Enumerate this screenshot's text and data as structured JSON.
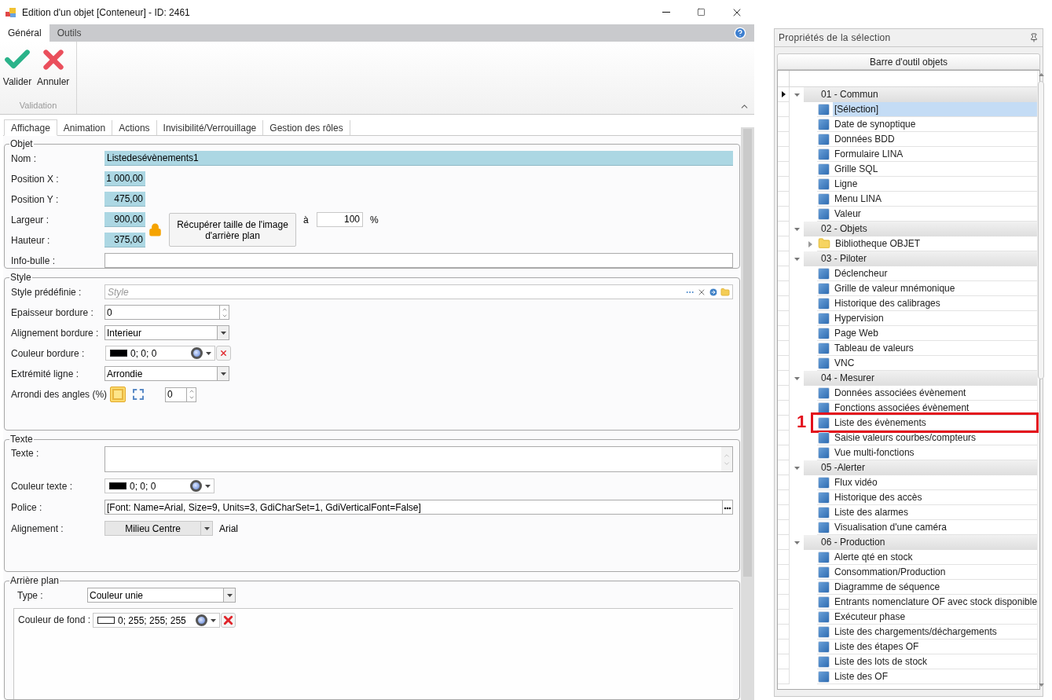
{
  "window": {
    "title": "Edition d'un objet [Conteneur] - ID: 2461"
  },
  "ribbon": {
    "tabs": [
      {
        "label": "Général",
        "selected": true
      },
      {
        "label": "Outils",
        "selected": false
      }
    ],
    "buttons": [
      {
        "kind": "ok",
        "label": "Valider"
      },
      {
        "kind": "cancel",
        "label": "Annuler"
      }
    ],
    "group_label": "Validation"
  },
  "tabs": [
    {
      "label": "Affichage",
      "selected": true
    },
    {
      "label": "Animation",
      "selected": false
    },
    {
      "label": "Actions",
      "selected": false
    },
    {
      "label": "Invisibilité/Verrouillage",
      "selected": false
    },
    {
      "label": "Gestion des rôles",
      "selected": false
    }
  ],
  "objet": {
    "title": "Objet",
    "name": {
      "label": "Nom :",
      "value": "Listedesévènements1"
    },
    "position_x": {
      "label": "Position X :",
      "value": "1 000,00"
    },
    "position_y": {
      "label": "Position Y :",
      "value": "475,00"
    },
    "width": {
      "label": "Largeur :",
      "value": "900,00"
    },
    "height": {
      "label": "Hauteur :",
      "value": "375,00"
    },
    "locked": true,
    "fetch_button": "Récupérer taille de l'image d'arrière plan",
    "scale": {
      "label": "à",
      "value": "100",
      "unit": "%"
    },
    "tooltip": {
      "label": "Info-bulle :"
    }
  },
  "style": {
    "title": "Style",
    "preset": {
      "label": "Style prédéfinie :",
      "placeholder": "Style"
    },
    "border_width": {
      "label": "Epaisseur bordure :",
      "value": "0"
    },
    "border_align": {
      "label": "Alignement bordure :",
      "value": "Interieur"
    },
    "border_color": {
      "label": "Couleur bordure :",
      "value": "0; 0; 0",
      "color": "#000000"
    },
    "line_end": {
      "label": "Extrémité ligne :",
      "value": "Arrondie"
    },
    "corner": {
      "label": "Arrondi des angles (%)",
      "value": "0",
      "modes": [
        {
          "selected": true
        },
        {
          "selected": false
        }
      ]
    }
  },
  "texte": {
    "title": "Texte",
    "text": {
      "label": "Texte :"
    },
    "color": {
      "label": "Couleur texte :",
      "value": "0; 0; 0",
      "color": "#000000"
    },
    "font": {
      "label": "Police :",
      "value": "[Font: Name=Arial, Size=9, Units=3, GdiCharSet=1, GdiVerticalFont=False]"
    },
    "align": {
      "label": "Alignement :",
      "value": "Milieu Centre",
      "font_name": "Arial"
    }
  },
  "background": {
    "title": "Arrière plan",
    "type": {
      "label": "Type :",
      "value": "Couleur unie"
    },
    "color": {
      "label": "Couleur de fond :",
      "value": "0; 255; 255; 255",
      "color": "#ffffff"
    }
  },
  "panel": {
    "title": "Propriétés de la sélection",
    "toolbar_title": "Barre d'outil objets",
    "groups": [
      {
        "label": "01 - Commun",
        "expanded": true,
        "current": true,
        "items": [
          {
            "label": "[Sélection]",
            "kind": "item",
            "selected": true
          },
          {
            "label": "Date de synoptique",
            "kind": "item",
            "selected": false
          },
          {
            "label": "Données BDD",
            "kind": "item",
            "selected": false
          },
          {
            "label": "Formulaire LINA",
            "kind": "item",
            "selected": false
          },
          {
            "label": "Grille SQL",
            "kind": "item",
            "selected": false
          },
          {
            "label": "Ligne",
            "kind": "item",
            "selected": false
          },
          {
            "label": "Menu LINA",
            "kind": "item",
            "selected": false
          },
          {
            "label": "Valeur",
            "kind": "item",
            "selected": false
          }
        ]
      },
      {
        "label": "02 - Objets",
        "expanded": true,
        "current": false,
        "items": [
          {
            "label": "Bibliotheque OBJET",
            "kind": "folder",
            "selected": false
          }
        ]
      },
      {
        "label": "03 - Piloter",
        "expanded": true,
        "current": false,
        "items": [
          {
            "label": "Déclencheur",
            "kind": "item",
            "selected": false
          },
          {
            "label": "Grille de valeur mnémonique",
            "kind": "item",
            "selected": false
          },
          {
            "label": "Historique des calibrages",
            "kind": "item",
            "selected": false
          },
          {
            "label": "Hypervision",
            "kind": "item",
            "selected": false
          },
          {
            "label": "Page Web",
            "kind": "item",
            "selected": false
          },
          {
            "label": "Tableau de valeurs",
            "kind": "item",
            "selected": false
          },
          {
            "label": "VNC",
            "kind": "item",
            "selected": false
          }
        ]
      },
      {
        "label": "04 - Mesurer",
        "expanded": true,
        "current": false,
        "items": [
          {
            "label": "Données associées évènement",
            "kind": "item",
            "selected": false
          },
          {
            "label": "Fonctions associées évènement",
            "kind": "item",
            "selected": false
          },
          {
            "label": "Liste des évènements",
            "kind": "item",
            "selected": false,
            "callout": "1"
          },
          {
            "label": "Saisie valeurs courbes/compteurs",
            "kind": "item",
            "selected": false
          },
          {
            "label": "Vue multi-fonctions",
            "kind": "item",
            "selected": false
          }
        ]
      },
      {
        "label": "05 -Alerter",
        "expanded": true,
        "current": false,
        "items": [
          {
            "label": "Flux vidéo",
            "kind": "item",
            "selected": false
          },
          {
            "label": "Historique des accès",
            "kind": "item",
            "selected": false
          },
          {
            "label": "Liste des alarmes",
            "kind": "item",
            "selected": false
          },
          {
            "label": "Visualisation d'une caméra",
            "kind": "item",
            "selected": false
          }
        ]
      },
      {
        "label": "06 - Production",
        "expanded": true,
        "current": false,
        "items": [
          {
            "label": "Alerte qté en stock",
            "kind": "item",
            "selected": false
          },
          {
            "label": "Consommation/Production",
            "kind": "item",
            "selected": false
          },
          {
            "label": "Diagramme de séquence",
            "kind": "item",
            "selected": false
          },
          {
            "label": "Entrants nomenclature OF avec stock disponible",
            "kind": "item",
            "selected": false
          },
          {
            "label": "Exécuteur phase",
            "kind": "item",
            "selected": false
          },
          {
            "label": "Liste des chargements/déchargements",
            "kind": "item",
            "selected": false
          },
          {
            "label": "Liste des étapes OF",
            "kind": "item",
            "selected": false
          },
          {
            "label": "Liste des lots de stock",
            "kind": "item",
            "selected": false
          },
          {
            "label": "Liste des OF",
            "kind": "item",
            "selected": false
          }
        ]
      }
    ]
  }
}
